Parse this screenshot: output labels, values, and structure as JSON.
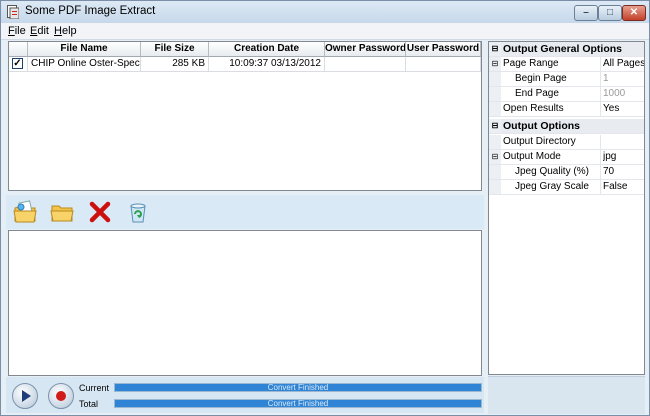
{
  "window": {
    "title": "Some PDF Image Extract"
  },
  "menu": [
    {
      "mnemonic": "F",
      "rest": "ile"
    },
    {
      "mnemonic": "E",
      "rest": "dit"
    },
    {
      "mnemonic": "H",
      "rest": "elp"
    }
  ],
  "files": {
    "columns": [
      "File Name",
      "File Size",
      "Creation Date",
      "Owner Password",
      "User Password"
    ],
    "rows": [
      {
        "checked": true,
        "name": "CHIP Online Oster-Speci...",
        "size": "285 KB",
        "date": "10:09:37 03/13/2012",
        "owner": "",
        "user": ""
      }
    ]
  },
  "toolbar": {
    "icons": [
      "add-file-icon",
      "add-folder-icon",
      "remove-icon",
      "clear-list-icon"
    ]
  },
  "progress": {
    "current_label": "Current",
    "total_label": "Total",
    "current_text": "Convert Finished",
    "total_text": "Convert Finished",
    "current_fraction": 1.0,
    "total_fraction": 1.0
  },
  "properties": {
    "general": {
      "title": "Output General Options",
      "page_range": {
        "name": "Page Range",
        "value": "All Pages"
      },
      "begin_page": {
        "name": "Begin Page",
        "value": "1"
      },
      "end_page": {
        "name": "End Page",
        "value": "1000"
      },
      "open_results": {
        "name": "Open Results",
        "value": "Yes"
      }
    },
    "output": {
      "title": "Output Options",
      "directory": {
        "name": "Output Directory",
        "value": ""
      },
      "mode": {
        "name": "Output Mode",
        "value": "jpg"
      },
      "quality": {
        "name": "Jpeg Quality (%)",
        "value": "70"
      },
      "gray": {
        "name": "Jpeg Gray Scale",
        "value": "False"
      }
    }
  },
  "colors": {
    "progress": "#2f84d6",
    "delete": "#cc1010",
    "folder": "#f0b830"
  }
}
